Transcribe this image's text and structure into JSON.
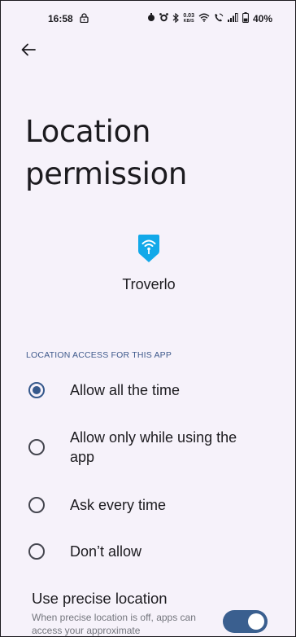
{
  "status_bar": {
    "time": "16:58",
    "left_icon": "lock-icon",
    "data_speed_value": "0.03",
    "data_speed_unit": "KB/S",
    "battery": "40%",
    "icons": [
      "alarm-clock-icon",
      "alarm-icon",
      "bluetooth-icon",
      "wifi-icon",
      "call-icon",
      "signal-icon",
      "battery-icon"
    ]
  },
  "header": {
    "back_icon": "arrow-back-icon",
    "title": "Location permission"
  },
  "app": {
    "icon": "wifi-pin-icon",
    "name": "Troverlo",
    "icon_color": "#12a9e9"
  },
  "location_access": {
    "section_label": "LOCATION ACCESS FOR THIS APP",
    "options": [
      {
        "label": "Allow all the time",
        "selected": true
      },
      {
        "label": "Allow only while using the app",
        "selected": false
      },
      {
        "label": "Ask every time",
        "selected": false
      },
      {
        "label": "Don’t allow",
        "selected": false
      }
    ]
  },
  "precise_location": {
    "title": "Use precise location",
    "description": "When precise location is off, apps can access your approximate",
    "enabled": true
  },
  "colors": {
    "background": "#f6f2fa",
    "accent": "#36598c",
    "section_label": "#3f5a8c",
    "toggle": "#3a5f8f"
  }
}
